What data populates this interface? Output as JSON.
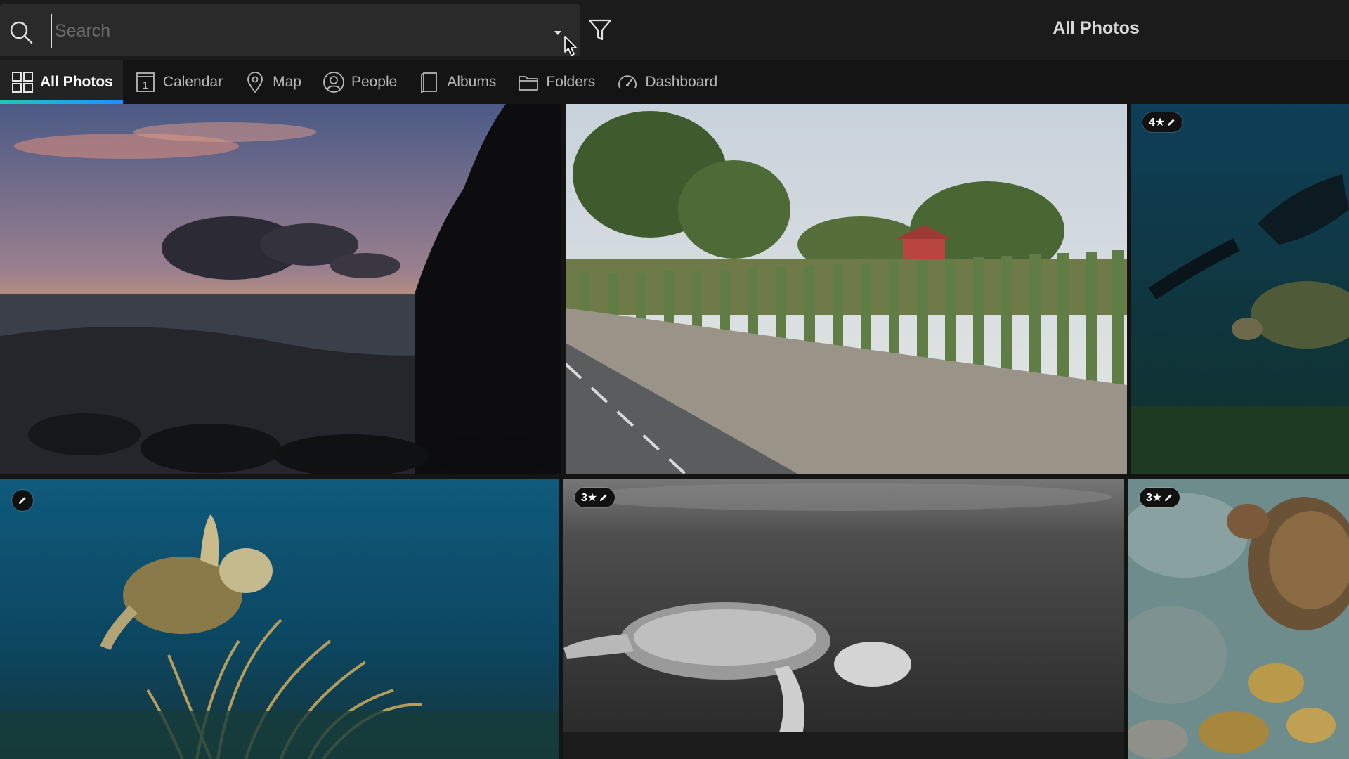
{
  "search": {
    "placeholder": "Search",
    "value": ""
  },
  "header": {
    "title": "All Photos"
  },
  "tabs": [
    {
      "label": "All Photos",
      "icon": "grid-icon",
      "active": true
    },
    {
      "label": "Calendar",
      "icon": "calendar-icon",
      "active": false
    },
    {
      "label": "Map",
      "icon": "map-pin-icon",
      "active": false
    },
    {
      "label": "People",
      "icon": "person-icon",
      "active": false
    },
    {
      "label": "Albums",
      "icon": "album-icon",
      "active": false
    },
    {
      "label": "Folders",
      "icon": "folder-icon",
      "active": false
    },
    {
      "label": "Dashboard",
      "icon": "gauge-icon",
      "active": false
    }
  ],
  "calendar_icon_day": "1",
  "photos": [
    {
      "id": "sunset-coast",
      "rating": "",
      "edited": false
    },
    {
      "id": "cactus-fence",
      "rating": "",
      "edited": false
    },
    {
      "id": "diver-turtle",
      "rating": "4★",
      "edited": true
    },
    {
      "id": "turtle-seagrass",
      "rating": "",
      "edited": true
    },
    {
      "id": "bw-turtle",
      "rating": "3★",
      "edited": true
    },
    {
      "id": "reef-turtle",
      "rating": "3★",
      "edited": true
    }
  ],
  "colors": {
    "accent_gradient_start": "#1ec9b8",
    "accent_gradient_end": "#1e90ff",
    "background": "#141414"
  }
}
